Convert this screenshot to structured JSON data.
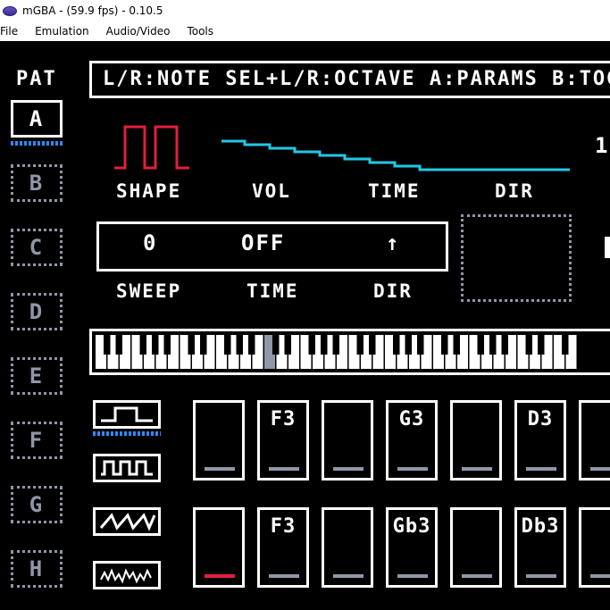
{
  "window": {
    "title": "mGBA -  (59.9 fps) - 0.10.5"
  },
  "menu": [
    "File",
    "Emulation",
    "Audio/Video",
    "Tools"
  ],
  "pattern": {
    "heading": "PAT",
    "items": [
      "A",
      "B",
      "C",
      "D",
      "E",
      "F",
      "G",
      "H"
    ],
    "selected": "A"
  },
  "help_text": "L/R:NOTE SEL+L/R:OCTAVE A:PARAMS B:TOG",
  "envelope": {
    "labels": [
      "SHAPE",
      "VOL",
      "TIME",
      "DIR"
    ],
    "top_right_number": "1"
  },
  "sweep": {
    "values": [
      "0",
      "OFF",
      "↑"
    ],
    "labels": [
      "SWEEP",
      "TIME",
      "DIR"
    ]
  },
  "keyboard": {
    "highlighted_key": "C3"
  },
  "channels": [
    {
      "wave_icon": "square-wave-wide-icon",
      "steps": [
        "",
        "F3",
        "",
        "G3",
        "",
        "D3",
        ""
      ]
    },
    {
      "wave_icon": "sawtooth-wave-icon",
      "steps": [
        "",
        "F3",
        "",
        "Gb3",
        "",
        "Db3",
        ""
      ]
    }
  ],
  "wave_buttons": [
    "square-wave-wide-icon",
    "square-wave-narrow-icon",
    "sawtooth-wave-icon",
    "noise-wave-icon"
  ],
  "colors": {
    "accent_red": "#e0203d",
    "accent_cyan": "#22c8e6",
    "accent_blue": "#2a8dff",
    "dim": "#8f97a8"
  }
}
